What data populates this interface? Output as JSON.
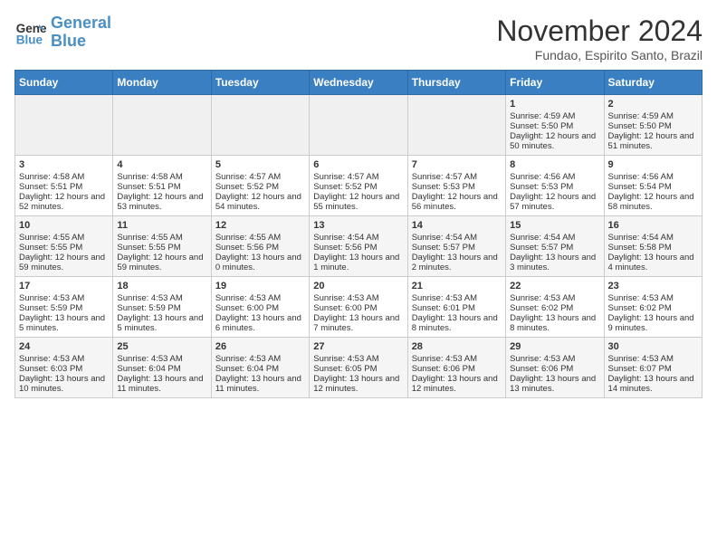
{
  "logo": {
    "line1": "General",
    "line2": "Blue"
  },
  "title": "November 2024",
  "subtitle": "Fundao, Espirito Santo, Brazil",
  "weekdays": [
    "Sunday",
    "Monday",
    "Tuesday",
    "Wednesday",
    "Thursday",
    "Friday",
    "Saturday"
  ],
  "weeks": [
    [
      {
        "day": "",
        "empty": true
      },
      {
        "day": "",
        "empty": true
      },
      {
        "day": "",
        "empty": true
      },
      {
        "day": "",
        "empty": true
      },
      {
        "day": "",
        "empty": true
      },
      {
        "day": "1",
        "sunrise": "4:59 AM",
        "sunset": "5:50 PM",
        "daylight": "12 hours and 50 minutes."
      },
      {
        "day": "2",
        "sunrise": "4:59 AM",
        "sunset": "5:50 PM",
        "daylight": "12 hours and 51 minutes."
      }
    ],
    [
      {
        "day": "3",
        "sunrise": "4:58 AM",
        "sunset": "5:51 PM",
        "daylight": "12 hours and 52 minutes."
      },
      {
        "day": "4",
        "sunrise": "4:58 AM",
        "sunset": "5:51 PM",
        "daylight": "12 hours and 53 minutes."
      },
      {
        "day": "5",
        "sunrise": "4:57 AM",
        "sunset": "5:52 PM",
        "daylight": "12 hours and 54 minutes."
      },
      {
        "day": "6",
        "sunrise": "4:57 AM",
        "sunset": "5:52 PM",
        "daylight": "12 hours and 55 minutes."
      },
      {
        "day": "7",
        "sunrise": "4:57 AM",
        "sunset": "5:53 PM",
        "daylight": "12 hours and 56 minutes."
      },
      {
        "day": "8",
        "sunrise": "4:56 AM",
        "sunset": "5:53 PM",
        "daylight": "12 hours and 57 minutes."
      },
      {
        "day": "9",
        "sunrise": "4:56 AM",
        "sunset": "5:54 PM",
        "daylight": "12 hours and 58 minutes."
      }
    ],
    [
      {
        "day": "10",
        "sunrise": "4:55 AM",
        "sunset": "5:55 PM",
        "daylight": "12 hours and 59 minutes."
      },
      {
        "day": "11",
        "sunrise": "4:55 AM",
        "sunset": "5:55 PM",
        "daylight": "12 hours and 59 minutes."
      },
      {
        "day": "12",
        "sunrise": "4:55 AM",
        "sunset": "5:56 PM",
        "daylight": "13 hours and 0 minutes."
      },
      {
        "day": "13",
        "sunrise": "4:54 AM",
        "sunset": "5:56 PM",
        "daylight": "13 hours and 1 minute."
      },
      {
        "day": "14",
        "sunrise": "4:54 AM",
        "sunset": "5:57 PM",
        "daylight": "13 hours and 2 minutes."
      },
      {
        "day": "15",
        "sunrise": "4:54 AM",
        "sunset": "5:57 PM",
        "daylight": "13 hours and 3 minutes."
      },
      {
        "day": "16",
        "sunrise": "4:54 AM",
        "sunset": "5:58 PM",
        "daylight": "13 hours and 4 minutes."
      }
    ],
    [
      {
        "day": "17",
        "sunrise": "4:53 AM",
        "sunset": "5:59 PM",
        "daylight": "13 hours and 5 minutes."
      },
      {
        "day": "18",
        "sunrise": "4:53 AM",
        "sunset": "5:59 PM",
        "daylight": "13 hours and 5 minutes."
      },
      {
        "day": "19",
        "sunrise": "4:53 AM",
        "sunset": "6:00 PM",
        "daylight": "13 hours and 6 minutes."
      },
      {
        "day": "20",
        "sunrise": "4:53 AM",
        "sunset": "6:00 PM",
        "daylight": "13 hours and 7 minutes."
      },
      {
        "day": "21",
        "sunrise": "4:53 AM",
        "sunset": "6:01 PM",
        "daylight": "13 hours and 8 minutes."
      },
      {
        "day": "22",
        "sunrise": "4:53 AM",
        "sunset": "6:02 PM",
        "daylight": "13 hours and 8 minutes."
      },
      {
        "day": "23",
        "sunrise": "4:53 AM",
        "sunset": "6:02 PM",
        "daylight": "13 hours and 9 minutes."
      }
    ],
    [
      {
        "day": "24",
        "sunrise": "4:53 AM",
        "sunset": "6:03 PM",
        "daylight": "13 hours and 10 minutes."
      },
      {
        "day": "25",
        "sunrise": "4:53 AM",
        "sunset": "6:04 PM",
        "daylight": "13 hours and 11 minutes."
      },
      {
        "day": "26",
        "sunrise": "4:53 AM",
        "sunset": "6:04 PM",
        "daylight": "13 hours and 11 minutes."
      },
      {
        "day": "27",
        "sunrise": "4:53 AM",
        "sunset": "6:05 PM",
        "daylight": "13 hours and 12 minutes."
      },
      {
        "day": "28",
        "sunrise": "4:53 AM",
        "sunset": "6:06 PM",
        "daylight": "13 hours and 12 minutes."
      },
      {
        "day": "29",
        "sunrise": "4:53 AM",
        "sunset": "6:06 PM",
        "daylight": "13 hours and 13 minutes."
      },
      {
        "day": "30",
        "sunrise": "4:53 AM",
        "sunset": "6:07 PM",
        "daylight": "13 hours and 14 minutes."
      }
    ]
  ]
}
